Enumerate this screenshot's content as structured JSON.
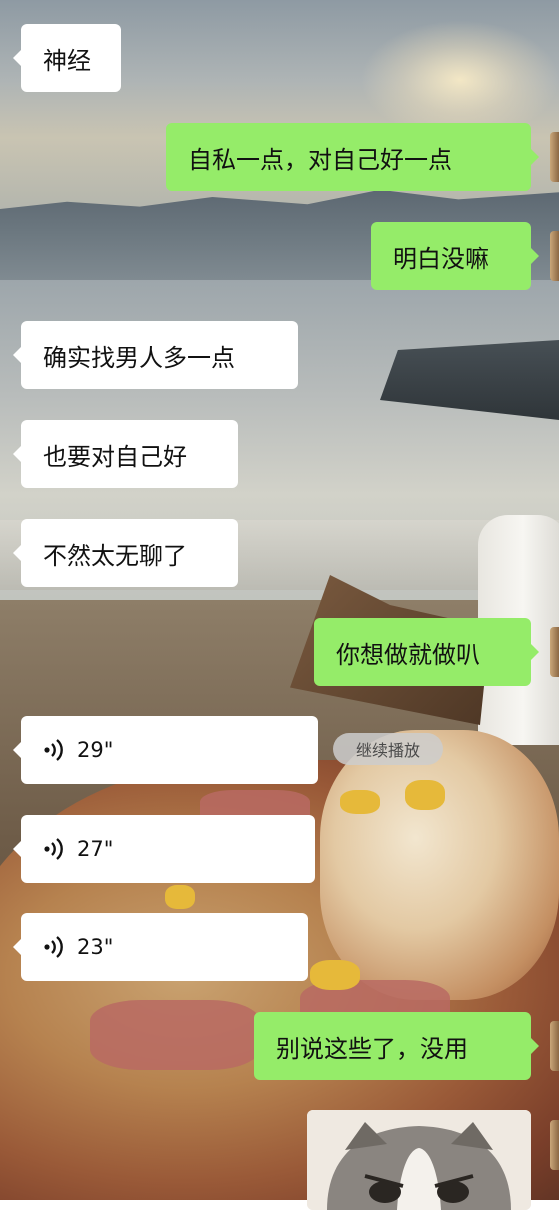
{
  "messages": [
    {
      "side": "left",
      "type": "text",
      "text": "神经"
    },
    {
      "side": "right",
      "type": "text",
      "text": "自私一点，对自己好一点"
    },
    {
      "side": "right",
      "type": "text",
      "text": "明白没嘛"
    },
    {
      "side": "left",
      "type": "text",
      "text": "确实找男人多一点"
    },
    {
      "side": "left",
      "type": "text",
      "text": "也要对自己好"
    },
    {
      "side": "left",
      "type": "text",
      "text": "不然太无聊了"
    },
    {
      "side": "right",
      "type": "text",
      "text": "你想做就做叭"
    },
    {
      "side": "left",
      "type": "voice",
      "duration": "29\""
    },
    {
      "side": "left",
      "type": "voice",
      "duration": "27\""
    },
    {
      "side": "left",
      "type": "voice",
      "duration": "23\""
    },
    {
      "side": "right",
      "type": "text",
      "text": "别说这些了，没用"
    },
    {
      "side": "right",
      "type": "sticker",
      "icon": "cat-sticker"
    }
  ],
  "continue_playback_label": "继续播放",
  "colors": {
    "sent_bubble": "#95ec69",
    "received_bubble": "#ffffff"
  }
}
